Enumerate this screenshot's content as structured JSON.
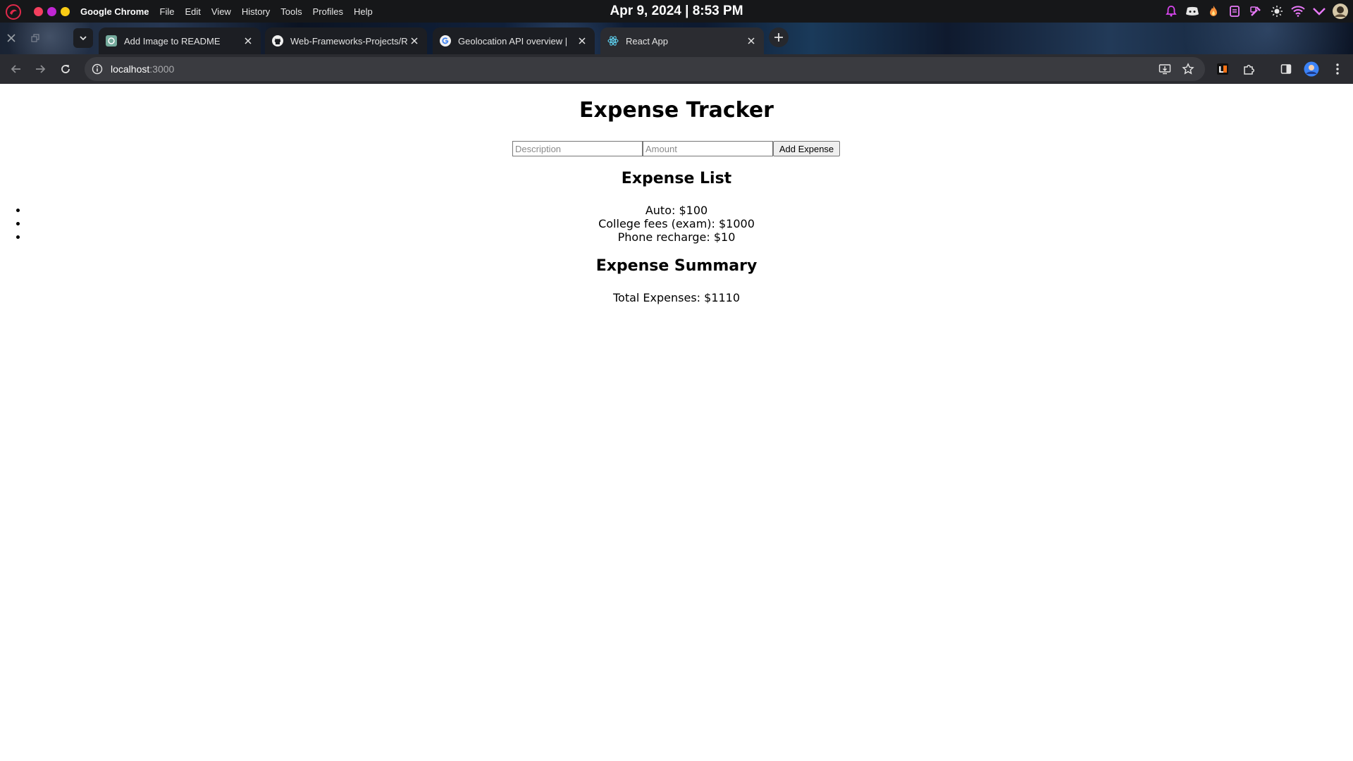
{
  "system_bar": {
    "app_name": "Google Chrome",
    "menu_items": [
      "File",
      "Edit",
      "View",
      "History",
      "Tools",
      "Profiles",
      "Help"
    ],
    "clock": "Apr 9, 2024 | 8:53 PM"
  },
  "tabs": [
    {
      "title": "Add Image to README",
      "favicon": "chatgpt-icon",
      "active": false
    },
    {
      "title": "Web-Frameworks-Projects/R",
      "favicon": "github-icon",
      "active": false
    },
    {
      "title": "Geolocation API overview |",
      "favicon": "google-icon",
      "active": false
    },
    {
      "title": "React App",
      "favicon": "react-icon",
      "active": true
    }
  ],
  "address_bar": {
    "host": "localhost",
    "port": ":3000"
  },
  "page": {
    "title": "Expense Tracker",
    "form": {
      "description_placeholder": "Description",
      "amount_placeholder": "Amount",
      "add_button": "Add Expense"
    },
    "list_heading": "Expense List",
    "expenses": [
      "Auto: $100",
      "College fees (exam): $1000",
      "Phone recharge: $10"
    ],
    "summary_heading": "Expense Summary",
    "total": "Total Expenses: $1110"
  },
  "colors": {
    "system_bar_bg": "#161719",
    "toolbar_bg": "#2b2c31",
    "omnibox_bg": "#3a3b40",
    "accent_pink": "#e879f9"
  }
}
